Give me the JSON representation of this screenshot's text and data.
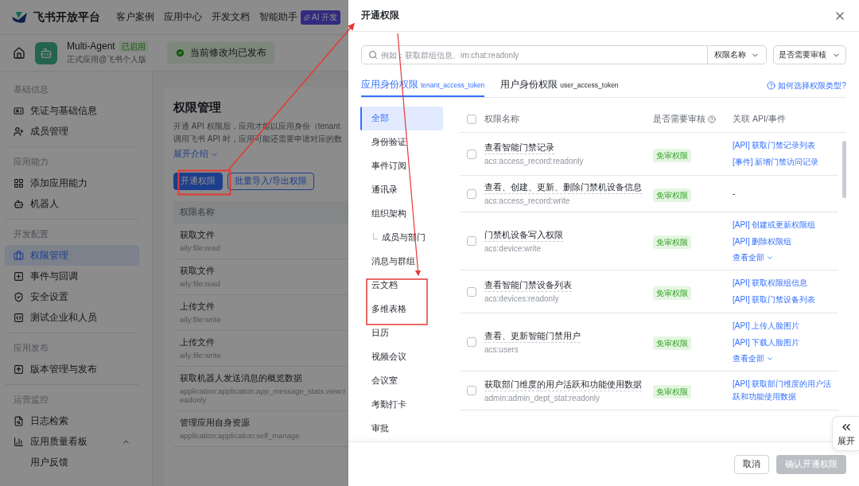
{
  "top_nav": {
    "logo": "飞书开放平台",
    "items": [
      "客户案例",
      "应用中心",
      "开发文档",
      "智能助手"
    ],
    "ai_badge": "AI 开发"
  },
  "app_header": {
    "app_name": "Multi-Agent",
    "app_status": "已启用",
    "app_subtitle": "正式应用@飞书个人版",
    "publish_status": "当前修改均已发布"
  },
  "sidebar": {
    "sections": [
      {
        "title": "基础信息",
        "items": [
          {
            "label": "凭证与基础信息",
            "selected": false
          },
          {
            "label": "成员管理",
            "selected": false
          }
        ]
      },
      {
        "title": "应用能力",
        "items": [
          {
            "label": "添加应用能力",
            "selected": false
          },
          {
            "label": "机器人",
            "selected": false
          }
        ]
      },
      {
        "title": "开发配置",
        "items": [
          {
            "label": "权限管理",
            "selected": true
          },
          {
            "label": "事件与回调",
            "selected": false
          },
          {
            "label": "安全设置",
            "selected": false
          },
          {
            "label": "测试企业和人员",
            "selected": false
          }
        ]
      },
      {
        "title": "应用发布",
        "items": [
          {
            "label": "版本管理与发布",
            "selected": false
          }
        ]
      },
      {
        "title": "运营监控",
        "items": [
          {
            "label": "日志检索",
            "selected": false
          },
          {
            "label": "应用质量看板",
            "selected": false,
            "expanded": true,
            "children": [
              {
                "label": "用户反馈",
                "selected": false
              }
            ]
          }
        ]
      }
    ]
  },
  "main": {
    "title": "权限管理",
    "description_lines": [
      "开通 API 权限后，应用才能以应用身份（tenant",
      "调用飞书 API 时，应用可能还需要申请对应的数"
    ],
    "expand_link": "展开介绍",
    "buttons": [
      {
        "label": "开通权限",
        "kind": "primary"
      },
      {
        "label": "批量导入/导出权限",
        "kind": "outline"
      }
    ],
    "table": {
      "columns": [
        "权限名称"
      ],
      "rows": [
        {
          "name": "获取文件",
          "code": "aily:file:read"
        },
        {
          "name": "获取文件",
          "code": "aily:file:read"
        },
        {
          "name": "上传文件",
          "code": "aily:file:write"
        },
        {
          "name": "上传文件",
          "code": "aily:file:write"
        },
        {
          "name": "获取机器人发送消息的概览数据",
          "code": "application:application.app_message_stats.view:readonly"
        },
        {
          "name": "管理应用自身资源",
          "code": "application:application:self_manage"
        }
      ]
    }
  },
  "dialog": {
    "title": "开通权限",
    "search": {
      "placeholder": "例如：获取群组信息、im:chat:readonly"
    },
    "filters": [
      "权限名称",
      "是否需要审核"
    ],
    "tabs": [
      {
        "label": "应用身份权限",
        "token": "tenant_access_token",
        "selected": true
      },
      {
        "label": "用户身份权限",
        "token": "user_access_token",
        "selected": false
      }
    ],
    "help_link": "如何选择权限类型?",
    "categories": [
      {
        "label": "全部",
        "selected": true
      },
      {
        "label": "身份验证",
        "selected": false
      },
      {
        "label": "事件订阅",
        "selected": false
      },
      {
        "label": "通讯录",
        "selected": false
      },
      {
        "label": "组织架构",
        "selected": false,
        "children": [
          {
            "label": "成员与部门",
            "selected": false
          }
        ]
      },
      {
        "label": "消息与群组",
        "selected": false
      },
      {
        "label": "云文档",
        "selected": false
      },
      {
        "label": "多维表格",
        "selected": false
      },
      {
        "label": "日历",
        "selected": false
      },
      {
        "label": "视频会议",
        "selected": false
      },
      {
        "label": "会议室",
        "selected": false
      },
      {
        "label": "考勤打卡",
        "selected": false
      },
      {
        "label": "审批",
        "selected": false
      }
    ],
    "table": {
      "columns": [
        "权限名称",
        "是否需要审核",
        "关联 API/事件"
      ],
      "all_checked": false,
      "rows": [
        {
          "checked": false,
          "name": "查看智能门禁记录",
          "code": "acs:access_record:readonly",
          "review": "免审权限",
          "links": [
            "[API] 获取门禁记录列表",
            "[事件] 新增门禁访问记录"
          ]
        },
        {
          "checked": false,
          "name": "查看、创建、更新、删除门禁机设备信息",
          "code": "acs:access_record:write",
          "review": "免审权限",
          "none_text": "-"
        },
        {
          "checked": false,
          "name": "门禁机设备写入权限",
          "code": "acs:device:write",
          "review": "免审权限",
          "links": [
            "[API] 创建或更新权限组",
            "[API] 删除权限组"
          ],
          "more": "查看全部"
        },
        {
          "checked": false,
          "name": "查看智能门禁设备列表",
          "code": "acs:devices:readonly",
          "review": "免审权限",
          "links": [
            "[API] 获取权限组信息",
            "[API] 获取门禁设备列表"
          ]
        },
        {
          "checked": false,
          "name": "查看、更新智能门禁用户",
          "code": "acs:users",
          "review": "免审权限",
          "links": [
            "[API] 上传人脸图片",
            "[API] 下载人脸图片"
          ],
          "more": "查看全部"
        },
        {
          "checked": false,
          "name": "获取部门维度的用户活跃和功能使用数据",
          "code": "admin:admin_dept_stat:readonly",
          "review": "免审权限",
          "links": [
            "[API] 获取部门维度的用户活跃和功能使用数据"
          ]
        }
      ]
    },
    "side_toggle": "展开",
    "footer": [
      {
        "label": "取消",
        "disabled": false,
        "kind": "default"
      },
      {
        "label": "确认开通权限",
        "disabled": true,
        "kind": "primary"
      }
    ]
  }
}
